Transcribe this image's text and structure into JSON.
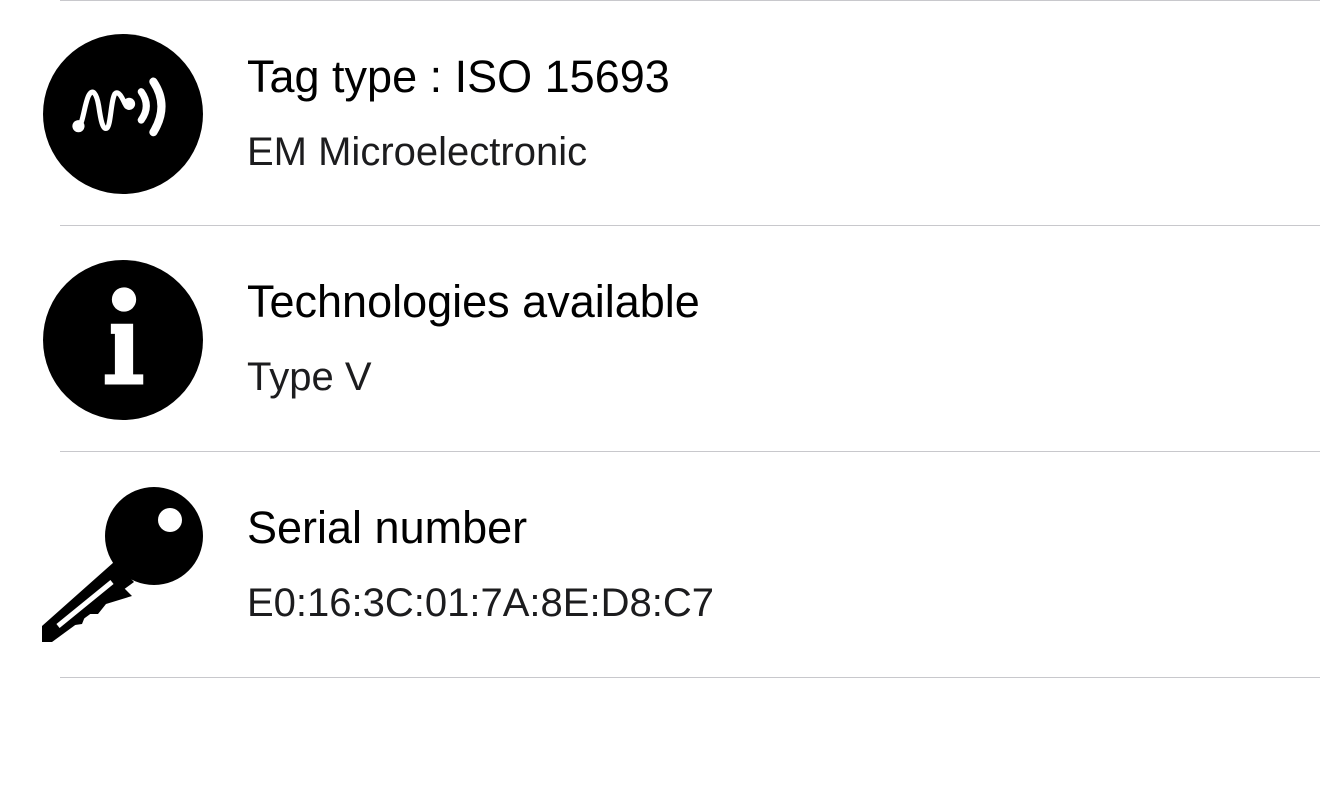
{
  "rows": [
    {
      "icon": "nfc-signal-icon",
      "title": "Tag type : ISO 15693",
      "subtitle": "EM Microelectronic"
    },
    {
      "icon": "info-icon",
      "title": "Technologies available",
      "subtitle": "Type V"
    },
    {
      "icon": "key-icon",
      "title": "Serial number",
      "subtitle": "E0:16:3C:01:7A:8E:D8:C7"
    }
  ],
  "colors": {
    "divider": "#c8c8cc",
    "icon": "#000000",
    "text": "#000000",
    "subtext": "#1c1c1e"
  }
}
